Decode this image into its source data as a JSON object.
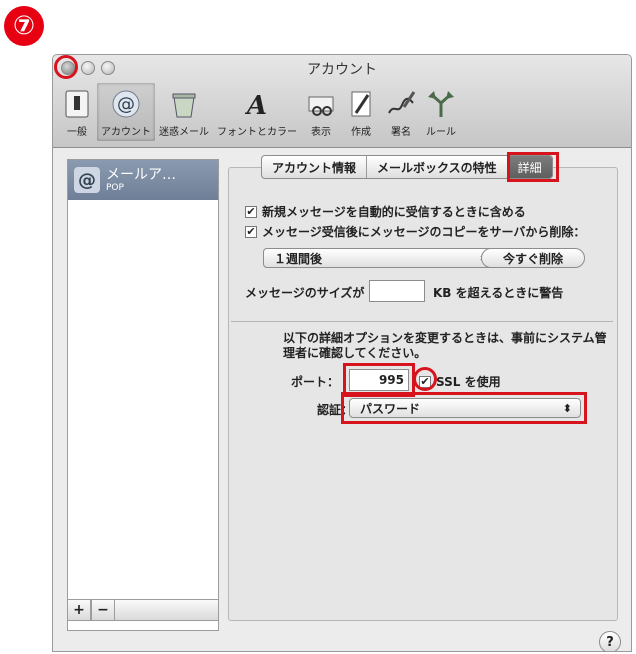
{
  "step_badge": "⑦",
  "window": {
    "title": "アカウント"
  },
  "toolbar": {
    "items": [
      {
        "label": "一般",
        "icon": "switch-icon"
      },
      {
        "label": "アカウント",
        "icon": "at-sign-icon",
        "selected": true
      },
      {
        "label": "迷惑メール",
        "icon": "trash-mail-icon"
      },
      {
        "label": "フォントとカラー",
        "icon": "font-icon"
      },
      {
        "label": "表示",
        "icon": "glasses-icon"
      },
      {
        "label": "作成",
        "icon": "pencil-icon"
      },
      {
        "label": "署名",
        "icon": "signature-icon"
      },
      {
        "label": "ルール",
        "icon": "rules-icon"
      }
    ]
  },
  "sidebar": {
    "accounts": [
      {
        "name": "メールア…",
        "type": "POP"
      }
    ],
    "add_label": "+",
    "remove_label": "−"
  },
  "tabs": [
    {
      "label": "アカウント情報"
    },
    {
      "label": "メールボックスの特性"
    },
    {
      "label": "詳細",
      "active": true
    }
  ],
  "options": {
    "include_auto_check": {
      "label": "新規メッセージを自動的に受信するときに含める",
      "checked": true
    },
    "remove_copy": {
      "label": "メッセージ受信後にメッセージのコピーをサーバから削除：",
      "checked": true
    },
    "remove_after": "１週間後",
    "remove_now": "今すぐ削除",
    "size_warning_prefix": "メッセージのサイズが",
    "size_warning_value": "",
    "size_warning_suffix": "KB を超えるときに警告"
  },
  "advanced": {
    "note": "以下の詳細オプションを変更するときは、事前にシステム管理者に確認してください。",
    "port_label": "ポート：",
    "port_value": "995",
    "ssl_label": "SSL を使用",
    "ssl_checked": true,
    "auth_label": "認証：",
    "auth_value": "パスワード"
  },
  "help_label": "?",
  "colors": {
    "highlight": "#d7141e",
    "selected_account": "#7a8aa3"
  }
}
